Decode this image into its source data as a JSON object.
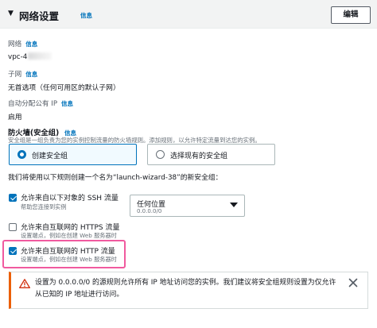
{
  "header": {
    "title": "网络设置",
    "info": "信息",
    "edit_label": "编辑"
  },
  "network": {
    "label": "网络",
    "info": "信息",
    "value": "vpc-4"
  },
  "subnet": {
    "label": "子网",
    "info": "信息",
    "value": "无首选项（任何可用区的默认子网）"
  },
  "auto_ip": {
    "label": "自动分配公有 IP",
    "info": "信息",
    "value": "启用"
  },
  "firewall": {
    "title": "防火墙(安全组)",
    "info": "信息",
    "description": "安全组是一组负责为您的实例控制流量的防火墙规则。添加规则，以允许特定流量到达您的实例。",
    "options": [
      {
        "label": "创建安全组",
        "selected": true
      },
      {
        "label": "选择现有的安全组",
        "selected": false
      }
    ],
    "create_note": "我们将使用以下规则创建一个名为“launch-wizard-38”的新安全组："
  },
  "rules": [
    {
      "title": "允许来自以下对象的 SSH 流量",
      "description": "帮助您连接到实例",
      "checked": true
    },
    {
      "title": "允许来自互联网的 HTTPS 流量",
      "description": "设置端点，例如在创建 Web 服务器时",
      "checked": false
    },
    {
      "title": "允许来自互联网的 HTTP 流量",
      "description": "设置端点，例如在创建 Web 服务器时",
      "checked": true
    }
  ],
  "ssh_source": {
    "value": "任何位置",
    "sub": "0.0.0.0/0"
  },
  "alert": {
    "text": "设置为 0.0.0.0/0 的源规则允许所有 IP 地址访问您的实例。我们建议将安全组规则设置为仅允许从已知的 IP 地址进行访问。"
  },
  "colors": {
    "accent": "#0073bb",
    "warning": "#eb5f07",
    "highlight": "#f05a9f"
  }
}
